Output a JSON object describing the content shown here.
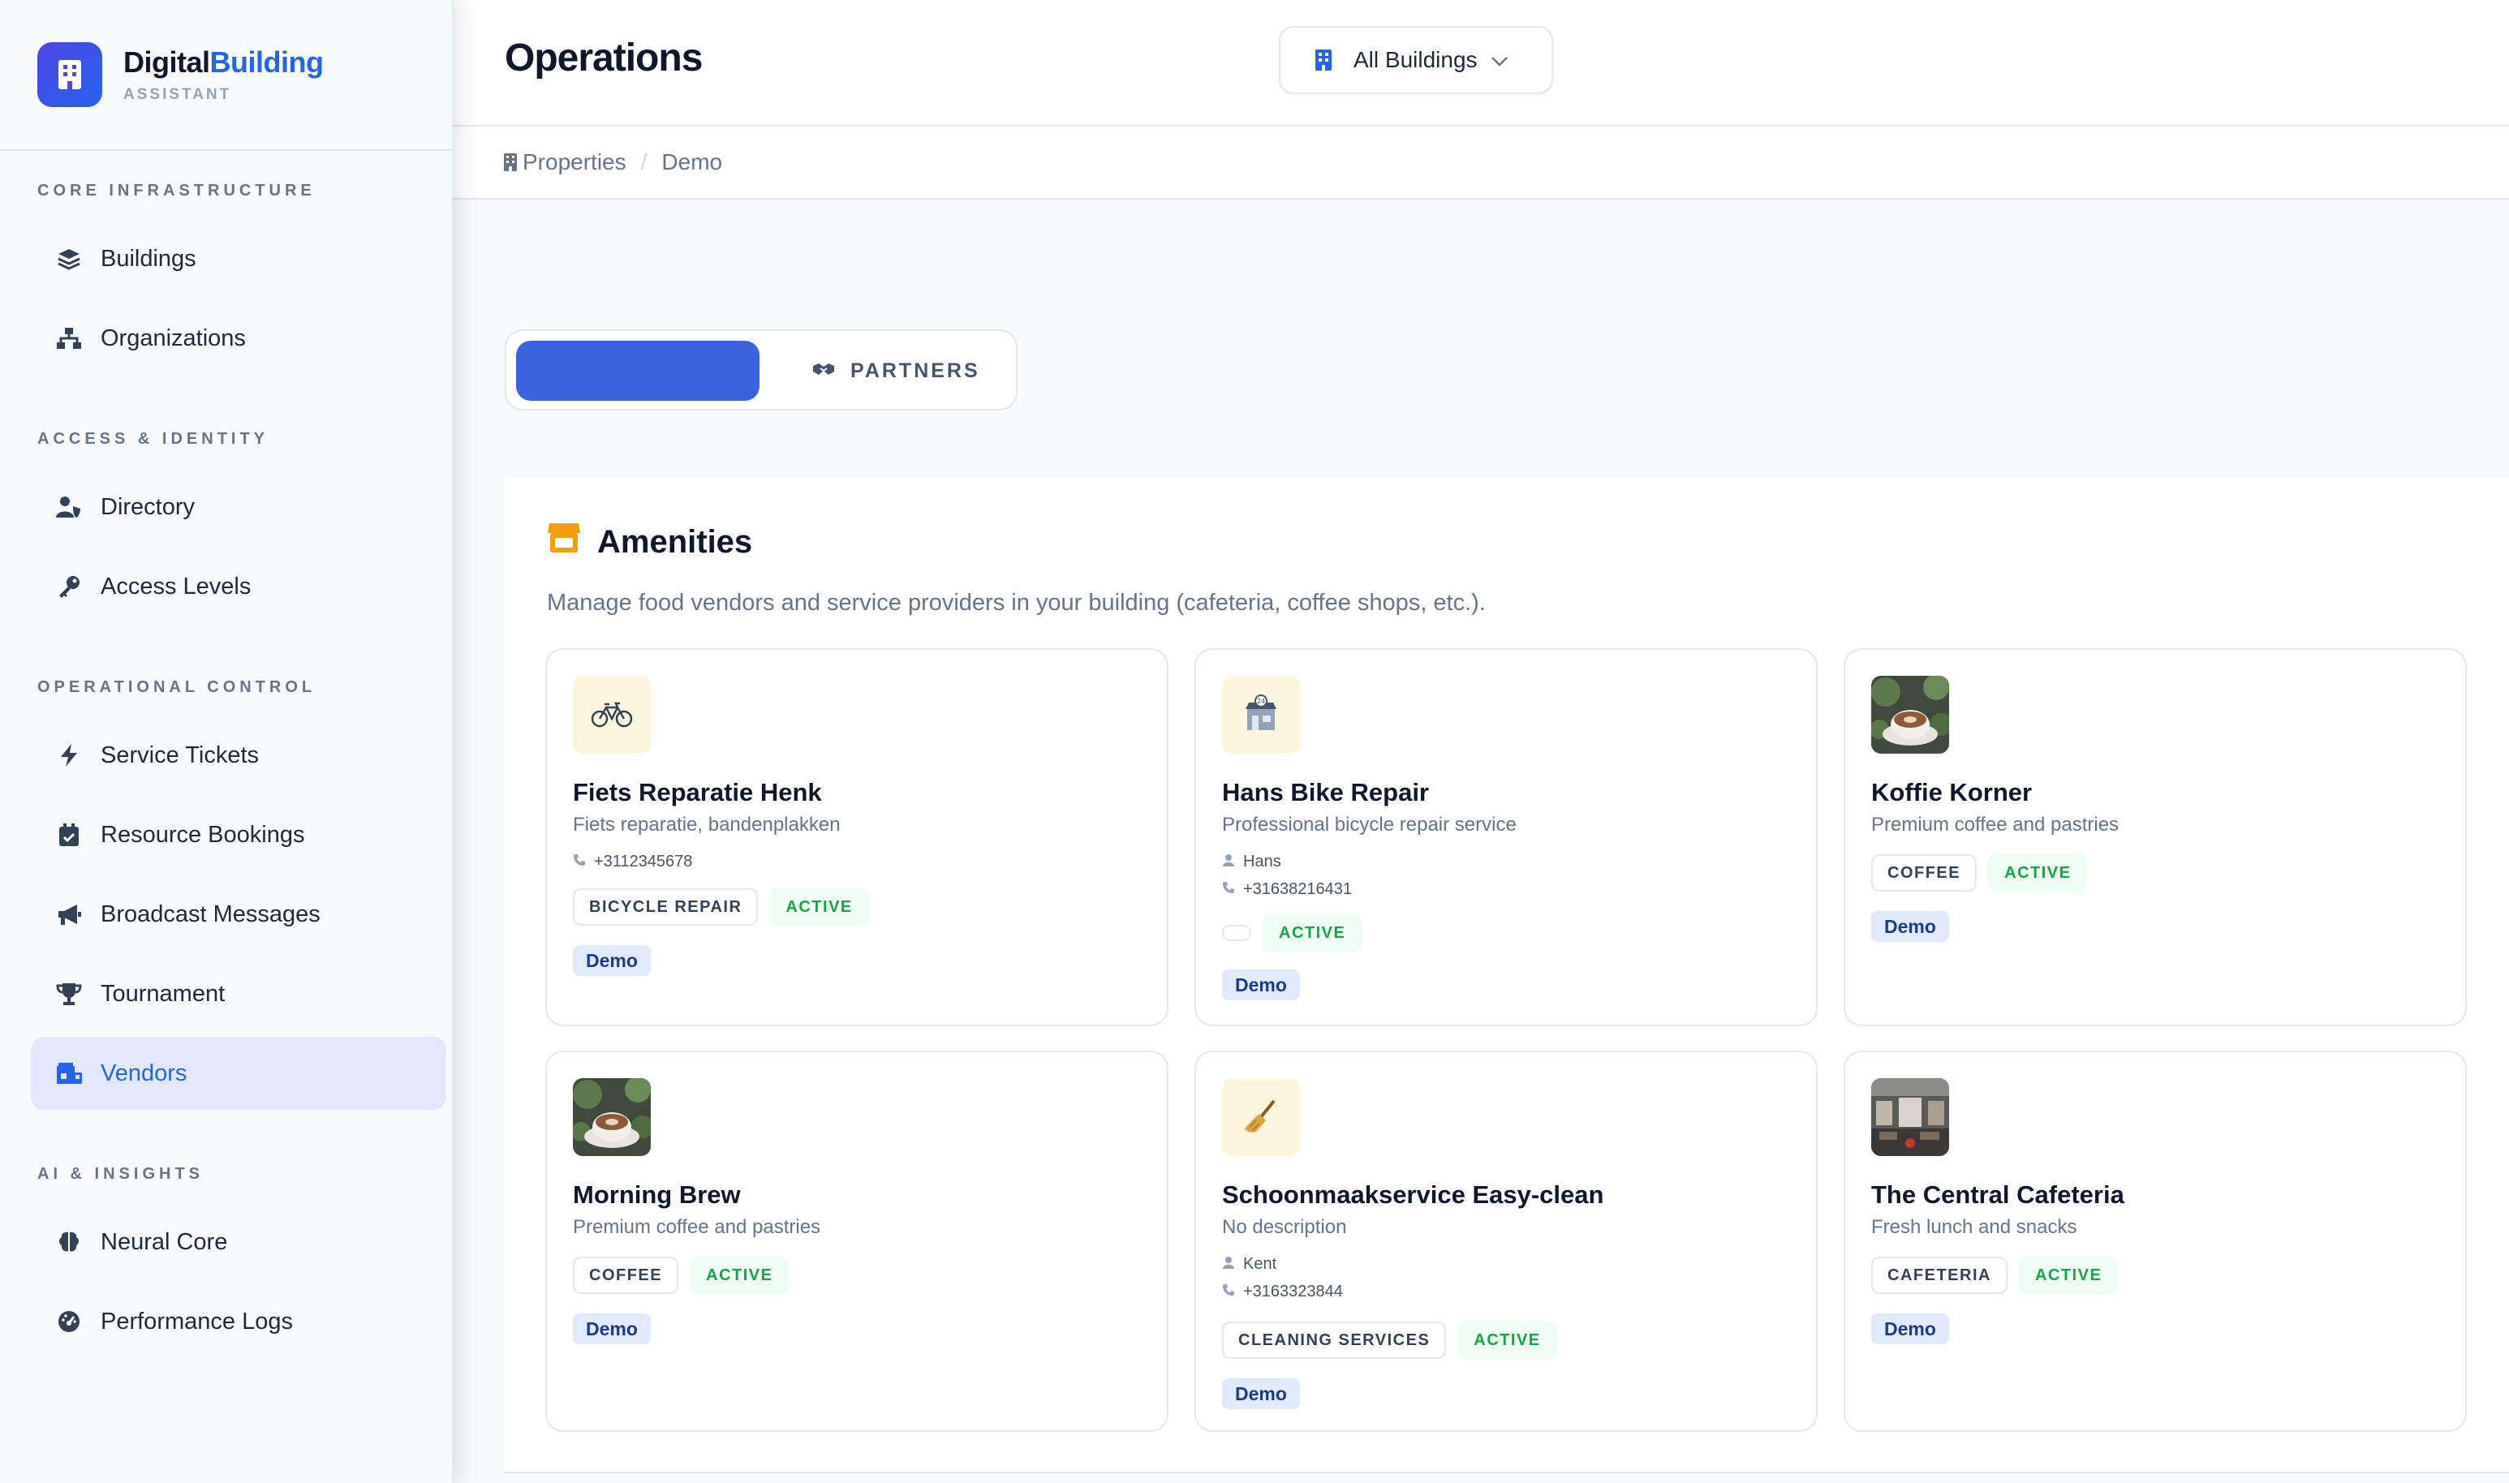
{
  "brand": {
    "name_part1": "Digital",
    "name_part2": "Building",
    "subtitle": "ASSISTANT"
  },
  "sidebar": {
    "sections": [
      {
        "label": "CORE INFRASTRUCTURE"
      },
      {
        "label": "ACCESS & IDENTITY"
      },
      {
        "label": "OPERATIONAL CONTROL"
      },
      {
        "label": "AI & INSIGHTS"
      }
    ],
    "items": [
      {
        "label": "Buildings",
        "icon": "layers-icon"
      },
      {
        "label": "Organizations",
        "icon": "sitemap-icon"
      },
      {
        "label": "Directory",
        "icon": "user-shield-icon"
      },
      {
        "label": "Access Levels",
        "icon": "key-icon"
      },
      {
        "label": "Service Tickets",
        "icon": "bolt-icon"
      },
      {
        "label": "Resource Bookings",
        "icon": "calendar-check-icon"
      },
      {
        "label": "Broadcast Messages",
        "icon": "megaphone-icon"
      },
      {
        "label": "Tournament",
        "icon": "trophy-icon"
      },
      {
        "label": "Vendors",
        "icon": "store-icon",
        "active": true
      },
      {
        "label": "Neural Core",
        "icon": "brain-icon"
      },
      {
        "label": "Performance Logs",
        "icon": "gauge-icon"
      }
    ]
  },
  "header": {
    "title": "Operations",
    "building_select": "All Buildings"
  },
  "breadcrumb": {
    "root": "Properties",
    "current": "Demo"
  },
  "tabs": {
    "active_label": "",
    "partners_label": "PARTNERS"
  },
  "panel": {
    "title": "Amenities",
    "description": "Manage food vendors and service providers in your building (cafeteria, coffee shops, etc.)."
  },
  "vendors": [
    {
      "name": "Fiets Reparatie Henk",
      "description": "Fiets reparatie, bandenplakken",
      "contact": "",
      "phone": "+3112345678",
      "category": "BICYCLE REPAIR",
      "status": "ACTIVE",
      "tag": "Demo",
      "thumb": "bicycle-icon"
    },
    {
      "name": "Hans Bike Repair",
      "description": "Professional bicycle repair service",
      "contact": "Hans",
      "phone": "+31638216431",
      "category": "",
      "status": "ACTIVE",
      "tag": "Demo",
      "thumb": "shop-icon"
    },
    {
      "name": "Koffie Korner",
      "description": "Premium coffee and pastries",
      "contact": "",
      "phone": "",
      "category": "COFFEE",
      "status": "ACTIVE",
      "tag": "Demo",
      "thumb": "coffee-photo"
    },
    {
      "name": "Morning Brew",
      "description": "Premium coffee and pastries",
      "contact": "",
      "phone": "",
      "category": "COFFEE",
      "status": "ACTIVE",
      "tag": "Demo",
      "thumb": "coffee-photo"
    },
    {
      "name": "Schoonmaakservice Easy-clean",
      "description": "No description",
      "contact": "Kent",
      "phone": "+3163323844",
      "category": "CLEANING SERVICES",
      "status": "ACTIVE",
      "tag": "Demo",
      "thumb": "broom-icon"
    },
    {
      "name": "The Central Cafeteria",
      "description": "Fresh lunch and snacks",
      "contact": "",
      "phone": "",
      "category": "CAFETERIA",
      "status": "ACTIVE",
      "tag": "Demo",
      "thumb": "cafeteria-photo"
    }
  ],
  "colors": {
    "accent": "#2563eb",
    "active_green": "#16a34a",
    "amber_icon": "#f59e0b"
  }
}
